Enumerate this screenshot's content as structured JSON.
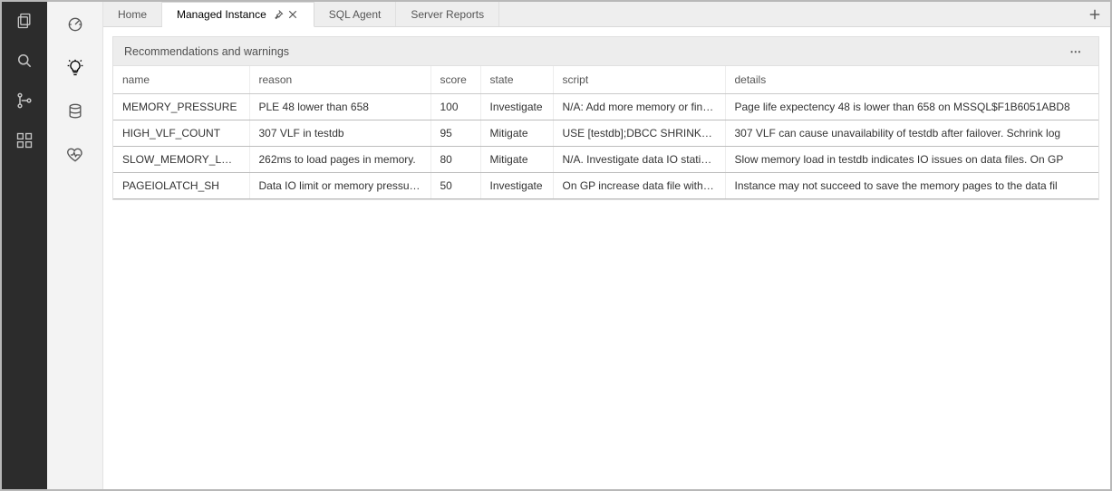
{
  "tabs": [
    {
      "label": "Home",
      "active": false
    },
    {
      "label": "Managed Instance",
      "active": true
    },
    {
      "label": "SQL Agent",
      "active": false
    },
    {
      "label": "Server Reports",
      "active": false
    }
  ],
  "panel": {
    "title": "Recommendations and warnings"
  },
  "columns": {
    "name": "name",
    "reason": "reason",
    "score": "score",
    "state": "state",
    "script": "script",
    "details": "details"
  },
  "rows": [
    {
      "name": "MEMORY_PRESSURE",
      "reason": "PLE 48 lower than 658",
      "score": "100",
      "state": "Investigate",
      "script": "N/A: Add more memory or fin…",
      "details": "Page life expectency 48 is lower than 658 on MSSQL$F1B6051ABD8"
    },
    {
      "name": "HIGH_VLF_COUNT",
      "reason": "307 VLF in testdb",
      "score": "95",
      "state": "Mitigate",
      "script": "USE [testdb];DBCC SHRINKFIL…",
      "details": "307 VLF can cause unavailability of testdb after failover. Schrink log"
    },
    {
      "name": "SLOW_MEMORY_LOAD",
      "reason": "262ms to load pages in memory.",
      "score": "80",
      "state": "Mitigate",
      "script": "N/A. Investigate data IO statis…",
      "details": "Slow memory load in testdb indicates IO issues on data files. On GP"
    },
    {
      "name": "PAGEIOLATCH_SH",
      "reason": "Data IO limit or memory pressure.",
      "score": "50",
      "state": "Investigate",
      "script": "On GP increase data file with l…",
      "details": "Instance may not succeed to save the memory pages to the data fil"
    }
  ]
}
